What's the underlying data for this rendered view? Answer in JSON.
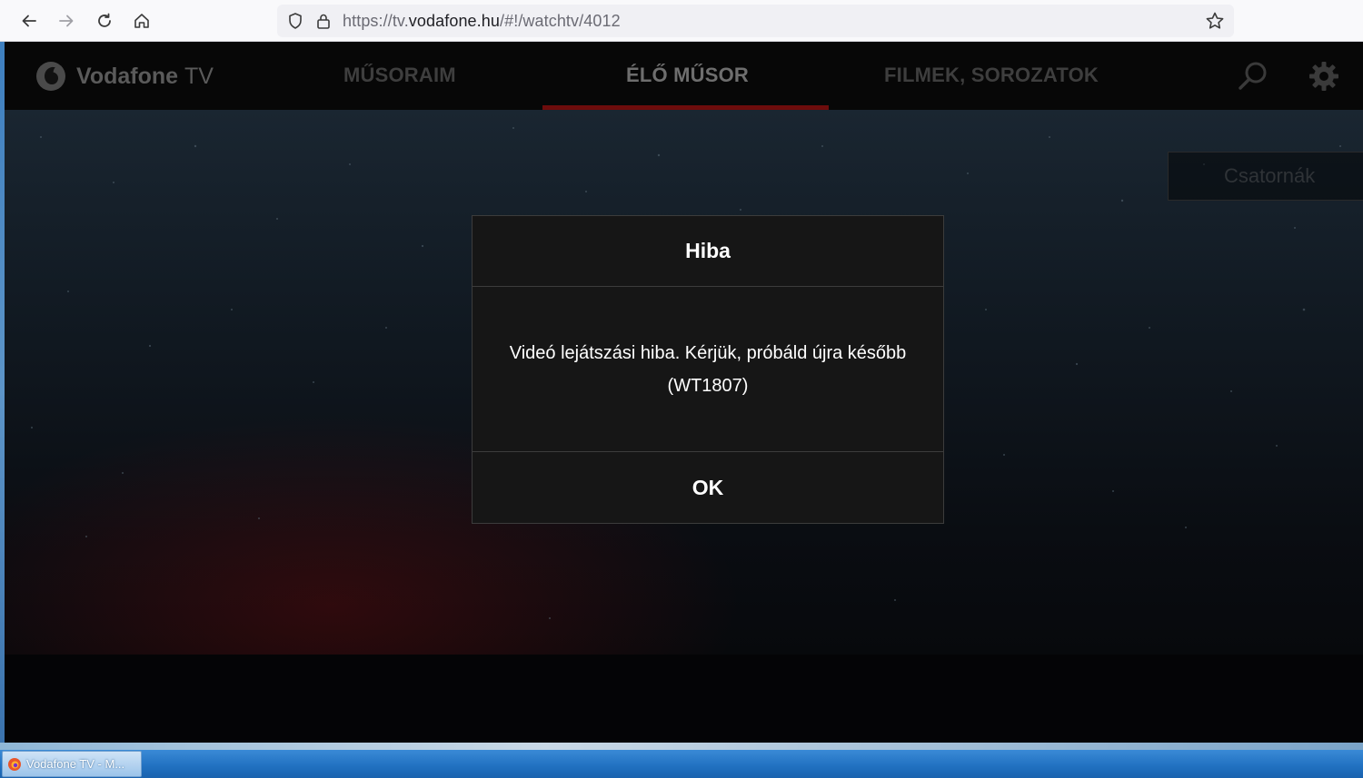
{
  "browser": {
    "url_prefix": "https://tv.",
    "url_domain": "vodafone.hu",
    "url_path": "/#!/watchtv/4012",
    "icons": [
      "back-icon",
      "forward-icon",
      "reload-icon",
      "home-icon",
      "shield-icon",
      "lock-icon",
      "bookmark-star-icon"
    ]
  },
  "app": {
    "brand_name": "Vodafone",
    "brand_suffix": "TV",
    "nav": {
      "my_shows": "MŰSORAIM",
      "live": "ÉLŐ MŰSOR",
      "movies_series": "FILMEK, SOROZATOK",
      "active": "ÉLŐ MŰSOR"
    },
    "channels_button": "Csatornák",
    "accent_color": "#6d0c0c"
  },
  "dialog": {
    "title": "Hiba",
    "message_line1": "Videó lejátszási hiba. Kérjük, próbáld újra később",
    "message_line2": "(WT1807)",
    "ok_label": "OK"
  },
  "taskbar": {
    "item_label": "Vodafone TV - M..."
  }
}
